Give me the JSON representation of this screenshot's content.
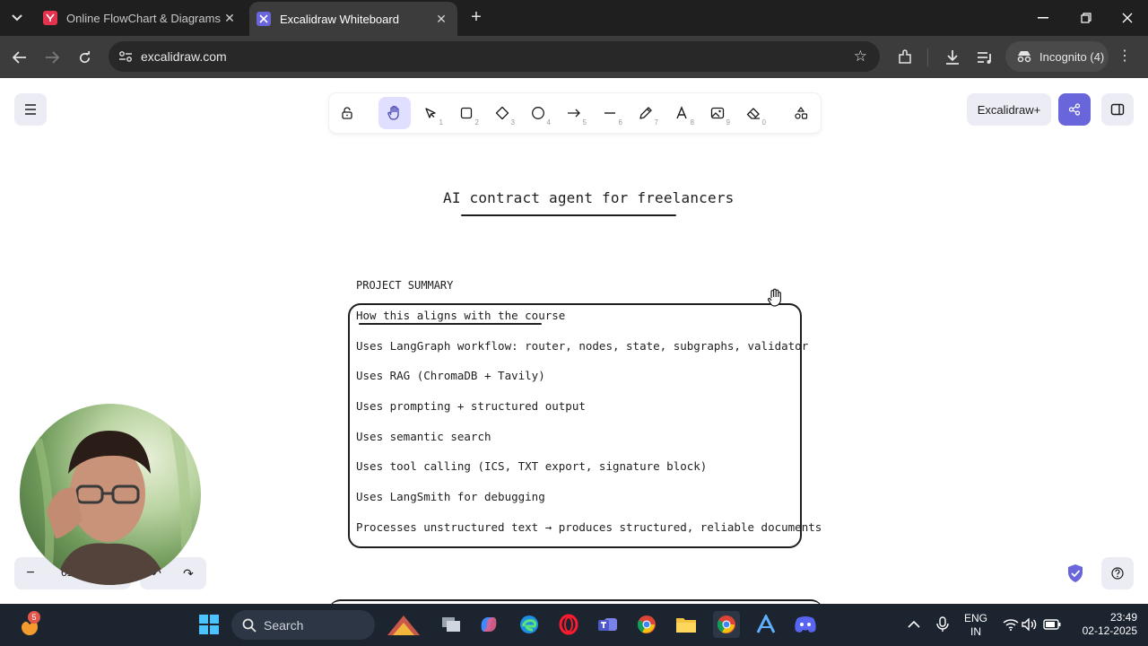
{
  "browser": {
    "tabs": [
      {
        "title": "Online FlowChart & Diagrams E",
        "active": false
      },
      {
        "title": "Excalidraw Whiteboard",
        "active": true
      }
    ],
    "url": "excalidraw.com",
    "profile_label": "Incognito (4)"
  },
  "excalidraw": {
    "toolbar": {
      "tools": [
        {
          "name": "lock",
          "key": ""
        },
        {
          "name": "hand",
          "key": "",
          "active": true
        },
        {
          "name": "selection",
          "key": "1"
        },
        {
          "name": "rectangle",
          "key": "2"
        },
        {
          "name": "diamond",
          "key": "3"
        },
        {
          "name": "ellipse",
          "key": "4"
        },
        {
          "name": "arrow",
          "key": "5"
        },
        {
          "name": "line",
          "key": "6"
        },
        {
          "name": "draw",
          "key": "7"
        },
        {
          "name": "text",
          "key": "8"
        },
        {
          "name": "image",
          "key": "9"
        },
        {
          "name": "eraser",
          "key": "0"
        },
        {
          "name": "extra-tools",
          "key": ""
        }
      ]
    },
    "plus_label": "Excalidraw+",
    "accent_color": "#6965db",
    "zoom": "61%"
  },
  "canvas": {
    "title": "AI contract agent for freelancers",
    "summary_label": "PROJECT SUMMARY",
    "box_heading": "How this aligns with the course",
    "box_lines": [
      "Uses LangGraph workflow: router, nodes, state, subgraphs, validator",
      "Uses RAG (ChromaDB + Tavily)",
      "Uses prompting + structured output",
      "Uses semantic search",
      "Uses tool calling (ICS, TXT export, signature block)",
      "Uses LangSmith for debugging",
      "Processes unstructured text → produces structured, reliable documents"
    ]
  },
  "taskbar": {
    "search_label": "Search",
    "notification_count": "5",
    "language": "ENG",
    "region": "IN",
    "time": "23:49",
    "date": "02-12-2025"
  }
}
